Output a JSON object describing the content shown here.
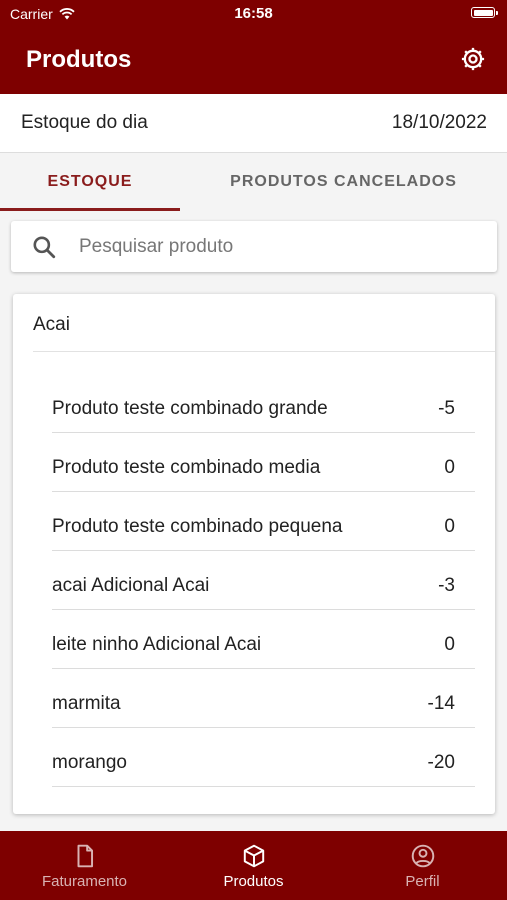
{
  "status_bar": {
    "carrier": "Carrier",
    "time": "16:58"
  },
  "header": {
    "title": "Produtos",
    "settings_icon": "gear-icon"
  },
  "stock_date": {
    "label": "Estoque do dia",
    "value": "18/10/2022"
  },
  "tabs": [
    {
      "label": "ESTOQUE",
      "active": true
    },
    {
      "label": "PRODUTOS CANCELADOS",
      "active": false
    }
  ],
  "search": {
    "placeholder": "Pesquisar produto",
    "value": "",
    "icon": "search-icon"
  },
  "category": {
    "title": "Acai",
    "items": [
      {
        "name": "Produto teste combinado grande",
        "qty": "-5"
      },
      {
        "name": "Produto teste combinado media",
        "qty": "0"
      },
      {
        "name": "Produto teste combinado pequena",
        "qty": "0"
      },
      {
        "name": "acai Adicional Acai",
        "qty": "-3"
      },
      {
        "name": "leite ninho Adicional Acai",
        "qty": "0"
      },
      {
        "name": "marmita",
        "qty": "-14"
      },
      {
        "name": "morango",
        "qty": "-20"
      }
    ]
  },
  "bottom_nav": [
    {
      "label": "Faturamento",
      "icon": "document-icon",
      "active": false
    },
    {
      "label": "Produtos",
      "icon": "box-icon",
      "active": true
    },
    {
      "label": "Perfil",
      "icon": "user-circle-icon",
      "active": false
    }
  ],
  "colors": {
    "brand": "#7e0000",
    "accent": "#8a1c1c"
  }
}
